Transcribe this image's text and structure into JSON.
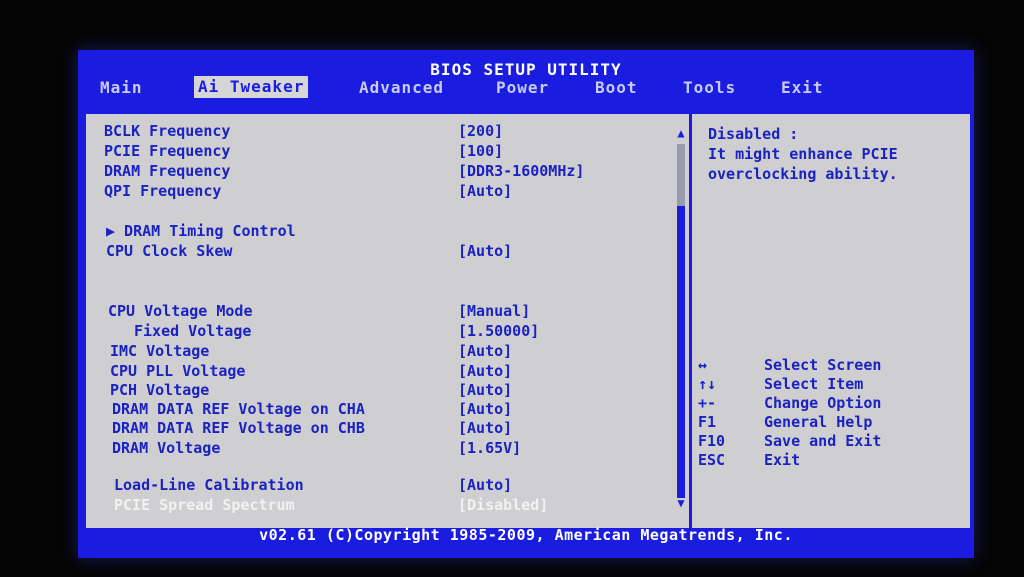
{
  "title": "BIOS SETUP UTILITY",
  "tabs": [
    "Main",
    "Ai Tweaker",
    "Advanced",
    "Power",
    "Boot",
    "Tools",
    "Exit"
  ],
  "active_tab": "Ai Tweaker",
  "settings": [
    {
      "label": "BCLK Frequency",
      "value": "[200]"
    },
    {
      "label": "PCIE Frequency",
      "value": "[100]"
    },
    {
      "label": "DRAM Frequency",
      "value": "[DDR3-1600MHz]"
    },
    {
      "label": "QPI Frequency",
      "value": "[Auto]"
    },
    {
      "label": "▶ DRAM Timing Control",
      "value": ""
    },
    {
      "label": "CPU Clock Skew",
      "value": "[Auto]"
    },
    {
      "label": "CPU Voltage Mode",
      "value": "[Manual]"
    },
    {
      "label": "Fixed Voltage",
      "value": "[1.50000]"
    },
    {
      "label": "IMC Voltage",
      "value": "[Auto]"
    },
    {
      "label": "CPU PLL Voltage",
      "value": "[Auto]"
    },
    {
      "label": "PCH Voltage",
      "value": "[Auto]"
    },
    {
      "label": "DRAM DATA REF Voltage on CHA",
      "value": "[Auto]"
    },
    {
      "label": "DRAM DATA REF Voltage on CHB",
      "value": "[Auto]"
    },
    {
      "label": "DRAM Voltage",
      "value": "[1.65V]"
    },
    {
      "label": "Load-Line Calibration",
      "value": "[Auto]"
    },
    {
      "label": "PCIE Spread Spectrum",
      "value": "[Disabled]"
    }
  ],
  "help": {
    "line1": "Disabled :",
    "line2": "It might enhance PCIE",
    "line3": "overclocking ability."
  },
  "keys": [
    {
      "key": "↔",
      "desc": "Select Screen"
    },
    {
      "key": "↑↓",
      "desc": "Select Item"
    },
    {
      "key": "+-",
      "desc": "Change Option"
    },
    {
      "key": "F1",
      "desc": "General Help"
    },
    {
      "key": "F10",
      "desc": "Save and Exit"
    },
    {
      "key": "ESC",
      "desc": "Exit"
    }
  ],
  "footer": "v02.61 (C)Copyright 1985-2009, American Megatrends, Inc.",
  "colors": {
    "bios_blue": "#1a1de0",
    "panel_gray": "#cfcfd2",
    "text_blue": "#1a22c0",
    "highlight_white": "#f2f2f2"
  }
}
